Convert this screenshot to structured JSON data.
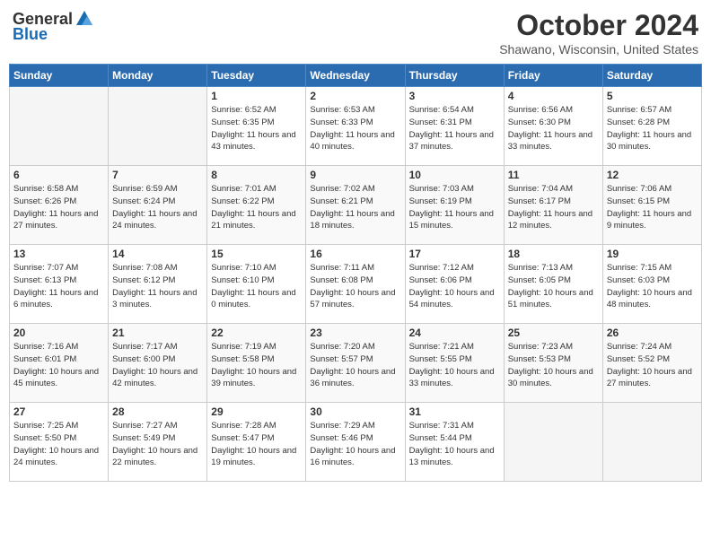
{
  "header": {
    "logo": {
      "general": "General",
      "blue": "Blue"
    },
    "title": "October 2024",
    "location": "Shawano, Wisconsin, United States"
  },
  "weekdays": [
    "Sunday",
    "Monday",
    "Tuesday",
    "Wednesday",
    "Thursday",
    "Friday",
    "Saturday"
  ],
  "weeks": [
    [
      {
        "day": "",
        "info": ""
      },
      {
        "day": "",
        "info": ""
      },
      {
        "day": "1",
        "info": "Sunrise: 6:52 AM\nSunset: 6:35 PM\nDaylight: 11 hours and 43 minutes."
      },
      {
        "day": "2",
        "info": "Sunrise: 6:53 AM\nSunset: 6:33 PM\nDaylight: 11 hours and 40 minutes."
      },
      {
        "day": "3",
        "info": "Sunrise: 6:54 AM\nSunset: 6:31 PM\nDaylight: 11 hours and 37 minutes."
      },
      {
        "day": "4",
        "info": "Sunrise: 6:56 AM\nSunset: 6:30 PM\nDaylight: 11 hours and 33 minutes."
      },
      {
        "day": "5",
        "info": "Sunrise: 6:57 AM\nSunset: 6:28 PM\nDaylight: 11 hours and 30 minutes."
      }
    ],
    [
      {
        "day": "6",
        "info": "Sunrise: 6:58 AM\nSunset: 6:26 PM\nDaylight: 11 hours and 27 minutes."
      },
      {
        "day": "7",
        "info": "Sunrise: 6:59 AM\nSunset: 6:24 PM\nDaylight: 11 hours and 24 minutes."
      },
      {
        "day": "8",
        "info": "Sunrise: 7:01 AM\nSunset: 6:22 PM\nDaylight: 11 hours and 21 minutes."
      },
      {
        "day": "9",
        "info": "Sunrise: 7:02 AM\nSunset: 6:21 PM\nDaylight: 11 hours and 18 minutes."
      },
      {
        "day": "10",
        "info": "Sunrise: 7:03 AM\nSunset: 6:19 PM\nDaylight: 11 hours and 15 minutes."
      },
      {
        "day": "11",
        "info": "Sunrise: 7:04 AM\nSunset: 6:17 PM\nDaylight: 11 hours and 12 minutes."
      },
      {
        "day": "12",
        "info": "Sunrise: 7:06 AM\nSunset: 6:15 PM\nDaylight: 11 hours and 9 minutes."
      }
    ],
    [
      {
        "day": "13",
        "info": "Sunrise: 7:07 AM\nSunset: 6:13 PM\nDaylight: 11 hours and 6 minutes."
      },
      {
        "day": "14",
        "info": "Sunrise: 7:08 AM\nSunset: 6:12 PM\nDaylight: 11 hours and 3 minutes."
      },
      {
        "day": "15",
        "info": "Sunrise: 7:10 AM\nSunset: 6:10 PM\nDaylight: 11 hours and 0 minutes."
      },
      {
        "day": "16",
        "info": "Sunrise: 7:11 AM\nSunset: 6:08 PM\nDaylight: 10 hours and 57 minutes."
      },
      {
        "day": "17",
        "info": "Sunrise: 7:12 AM\nSunset: 6:06 PM\nDaylight: 10 hours and 54 minutes."
      },
      {
        "day": "18",
        "info": "Sunrise: 7:13 AM\nSunset: 6:05 PM\nDaylight: 10 hours and 51 minutes."
      },
      {
        "day": "19",
        "info": "Sunrise: 7:15 AM\nSunset: 6:03 PM\nDaylight: 10 hours and 48 minutes."
      }
    ],
    [
      {
        "day": "20",
        "info": "Sunrise: 7:16 AM\nSunset: 6:01 PM\nDaylight: 10 hours and 45 minutes."
      },
      {
        "day": "21",
        "info": "Sunrise: 7:17 AM\nSunset: 6:00 PM\nDaylight: 10 hours and 42 minutes."
      },
      {
        "day": "22",
        "info": "Sunrise: 7:19 AM\nSunset: 5:58 PM\nDaylight: 10 hours and 39 minutes."
      },
      {
        "day": "23",
        "info": "Sunrise: 7:20 AM\nSunset: 5:57 PM\nDaylight: 10 hours and 36 minutes."
      },
      {
        "day": "24",
        "info": "Sunrise: 7:21 AM\nSunset: 5:55 PM\nDaylight: 10 hours and 33 minutes."
      },
      {
        "day": "25",
        "info": "Sunrise: 7:23 AM\nSunset: 5:53 PM\nDaylight: 10 hours and 30 minutes."
      },
      {
        "day": "26",
        "info": "Sunrise: 7:24 AM\nSunset: 5:52 PM\nDaylight: 10 hours and 27 minutes."
      }
    ],
    [
      {
        "day": "27",
        "info": "Sunrise: 7:25 AM\nSunset: 5:50 PM\nDaylight: 10 hours and 24 minutes."
      },
      {
        "day": "28",
        "info": "Sunrise: 7:27 AM\nSunset: 5:49 PM\nDaylight: 10 hours and 22 minutes."
      },
      {
        "day": "29",
        "info": "Sunrise: 7:28 AM\nSunset: 5:47 PM\nDaylight: 10 hours and 19 minutes."
      },
      {
        "day": "30",
        "info": "Sunrise: 7:29 AM\nSunset: 5:46 PM\nDaylight: 10 hours and 16 minutes."
      },
      {
        "day": "31",
        "info": "Sunrise: 7:31 AM\nSunset: 5:44 PM\nDaylight: 10 hours and 13 minutes."
      },
      {
        "day": "",
        "info": ""
      },
      {
        "day": "",
        "info": ""
      }
    ]
  ]
}
